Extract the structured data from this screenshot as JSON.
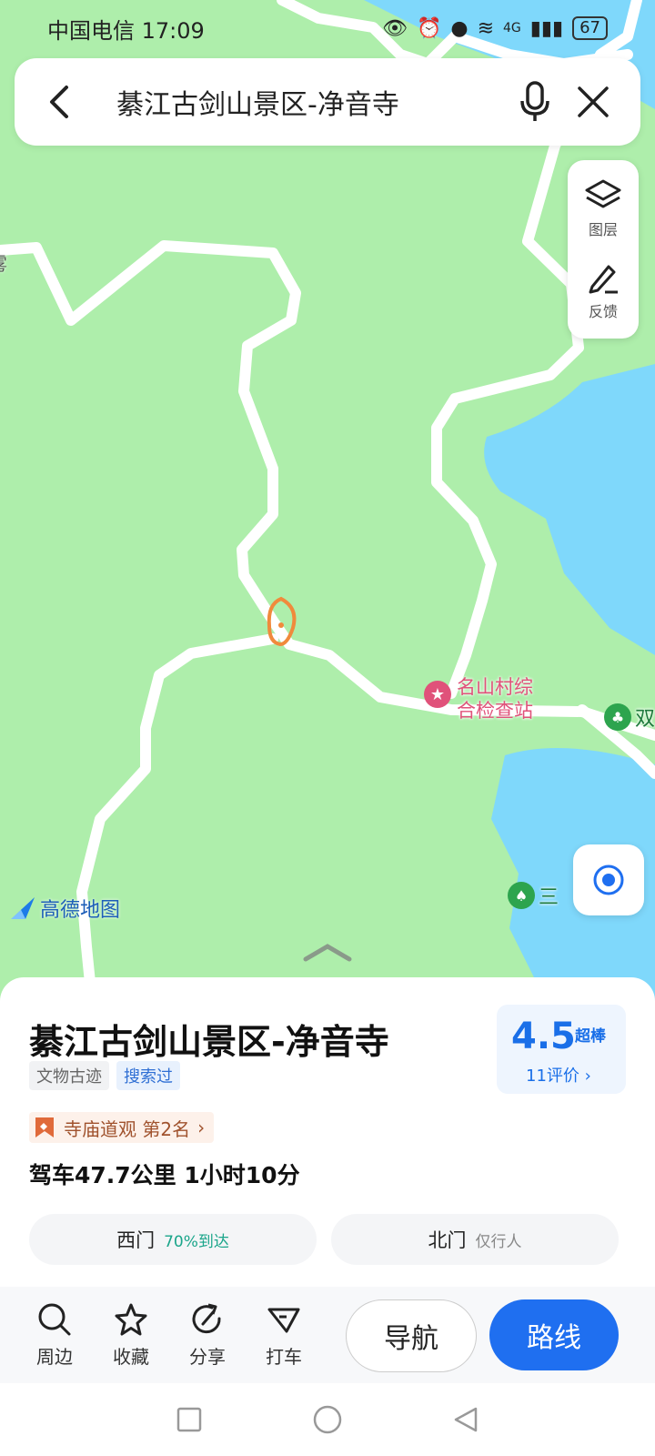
{
  "status_bar": {
    "carrier": "中国电信",
    "time": "17:09",
    "network": "4G",
    "battery": "67"
  },
  "search": {
    "query": "綦江古剑山景区-净音寺"
  },
  "map_tools": {
    "layers_label": "图层",
    "feedback_label": "反馈"
  },
  "map": {
    "poi_checkpoint": [
      "名山村综",
      "合检查站"
    ],
    "poi_right_edge": "双",
    "poi_bottom": "三",
    "logo_text": "高德地图",
    "left_edge_text": "雾"
  },
  "place": {
    "title": "綦江古剑山景区-净音寺",
    "tags": [
      "文物古迹",
      "搜索过"
    ],
    "rating": "4.5",
    "rating_word": "超棒",
    "review_count": "11评价",
    "rank": "寺庙道观 第2名",
    "drive": "驾车47.7公里  1小时10分",
    "gates": [
      {
        "name": "西门",
        "note": "70%到达"
      },
      {
        "name": "北门",
        "note": "仅行人"
      }
    ]
  },
  "actions": {
    "nearby": "周边",
    "favorite": "收藏",
    "share": "分享",
    "taxi": "打车",
    "navigate": "导航",
    "route": "路线"
  },
  "colors": {
    "map_green": "#aeeeab",
    "water": "#7fd8fb",
    "road": "#ffffff",
    "accent_blue": "#1f6ff0",
    "poi_red": "#e0527a",
    "marker_orange": "#f08a3c"
  }
}
